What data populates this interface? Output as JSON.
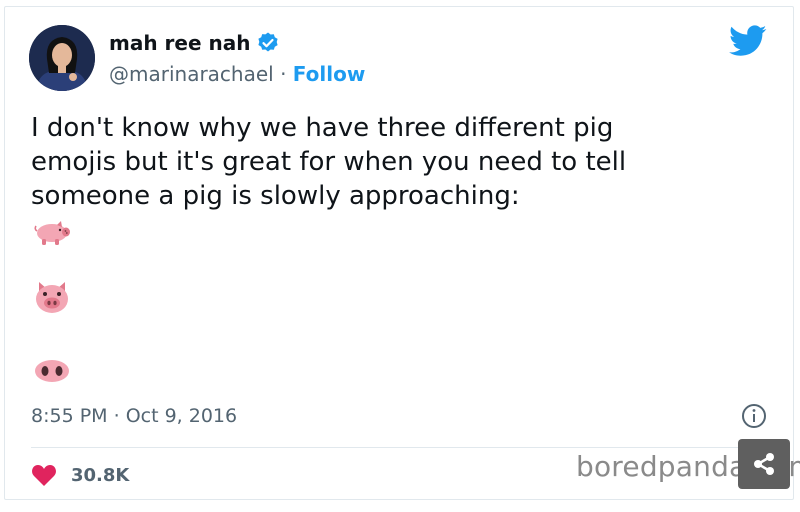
{
  "tweet": {
    "display_name": "mah ree nah",
    "handle": "@marinarachael",
    "separator": " · ",
    "follow_label": "Follow",
    "text": "I don't know why we have three different pig\nemojis but it's great for when you need to tell\nsomeone a pig is slowly approaching:",
    "emojis": [
      "pig-icon",
      "pig-face-icon",
      "pig-nose-icon"
    ],
    "time": "8:55 PM",
    "date_separator": " · ",
    "date": "Oct 9, 2016",
    "likes": "30.8K"
  },
  "watermark": "boredpanda.com",
  "colors": {
    "link": "#1d9bf0",
    "heart": "#e0245e",
    "muted": "#536471",
    "pig_pink": "#f3a6b4",
    "pig_dark": "#e2798b"
  }
}
